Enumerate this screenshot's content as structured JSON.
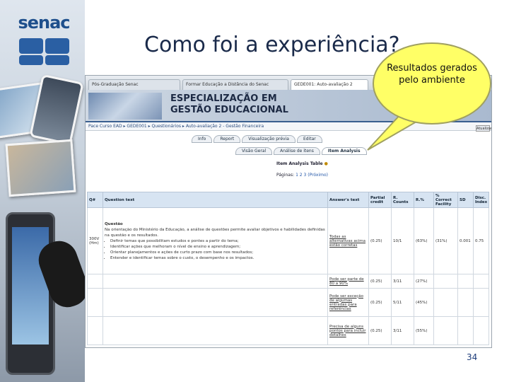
{
  "slide": {
    "title": "Como foi a experiência?",
    "page_number": "34",
    "logo_text": "senac",
    "callout": "Resultados gerados pelo ambiente"
  },
  "browser": {
    "tabs": [
      {
        "label": "Pós-Graduação Senac",
        "active": false
      },
      {
        "label": "Formar Educação a Distância do Senac",
        "active": false
      },
      {
        "label": "GEDE001: Auto-avaliação 2",
        "active": true
      }
    ]
  },
  "moodle": {
    "banner_line1": "ESPECIALIZAÇÃO EM",
    "banner_line2": "GESTÃO EDUCACIONAL",
    "breadcrumb": "Pace Curso EAD ▸ GEDE001 ▸ Questionários ▸ Auto-avaliação 2 - Gestão Financeira",
    "side_button": "Atualizar",
    "tabs_row1": [
      "Info",
      "Report",
      "Visualização prévia",
      "Editar"
    ],
    "tabs_row2": [
      "Visão Geral",
      "Análise de itens",
      "Item Analysis"
    ],
    "tabs_row2_selected": "Item Analysis",
    "item_analysis_title": "Item Analysis Table",
    "pager_label": "Páginas:",
    "pager_pages": "1 2 3 (Próximo)",
    "columns": [
      "Q#",
      "Question text",
      "Answer's text",
      "Partial credit",
      "R. Counts",
      "R.%",
      "% Correct Facility",
      "SD",
      "Disc. Index"
    ],
    "question": {
      "number": "300V (Hm)",
      "text_title": "Questão",
      "text_intro": "Na orientação do Ministério da Educação, a análise de questões permite avaliar objetivos e habilidades definidas na questão e os resultados.",
      "bullets": [
        "Definir temas que possibilitam estudos e pontes a partir do tema;",
        "Identificar ações que melhoram o nível de ensino e aprendizagem;",
        "Orientar planejamentos e ações de curto prazo com base nos resultados;",
        "Entender e identificar temas sobre o custo, o desempenho e os impactos."
      ]
    },
    "rows": [
      {
        "answer": "Todas as alternativas acima estão corretas",
        "partial": "(0.25)",
        "counts": "10/1",
        "pct": "(63%)",
        "facility": "(31%)",
        "sd": "0.001",
        "disc": "0.75"
      },
      {
        "answer": "Pode ser parte de 80 a 90%",
        "partial": "(0.25)",
        "counts": "3/11",
        "pct": "(27%)",
        "facility": "",
        "sd": "",
        "disc": ""
      },
      {
        "answer": "Pode ser exceção de algumas entradas para referências",
        "partial": "(0.25)",
        "counts": "5/11",
        "pct": "(45%)",
        "facility": "",
        "sd": "",
        "disc": ""
      },
      {
        "answer": "Precisa de alguns pontos para incluir detalhes",
        "partial": "(0.25)",
        "counts": "3/11",
        "pct": "(55%)",
        "facility": "",
        "sd": "",
        "disc": ""
      }
    ]
  }
}
